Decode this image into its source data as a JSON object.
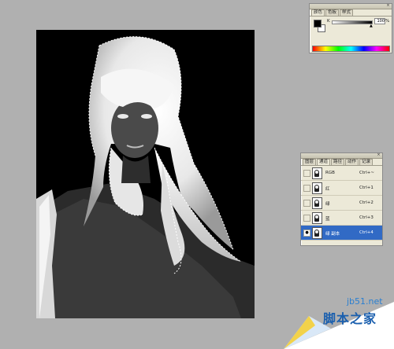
{
  "color_palette": {
    "tabs": [
      "颜色",
      "色板",
      "样式"
    ],
    "channel_label": "K",
    "value": "100",
    "unit": "%"
  },
  "channels_palette": {
    "tabs": [
      "图层",
      "通道",
      "路径",
      "动作",
      "记录"
    ],
    "rows": [
      {
        "name": "RGB",
        "shortcut": "Ctrl+~",
        "visible": false,
        "selected": false
      },
      {
        "name": "红",
        "shortcut": "Ctrl+1",
        "visible": false,
        "selected": false
      },
      {
        "name": "绿",
        "shortcut": "Ctrl+2",
        "visible": false,
        "selected": false
      },
      {
        "name": "蓝",
        "shortcut": "Ctrl+3",
        "visible": false,
        "selected": false
      },
      {
        "name": "绿 副本",
        "shortcut": "Ctrl+4",
        "visible": true,
        "selected": true
      }
    ]
  },
  "watermark": {
    "url": "jb51.net",
    "name": "脚本之家"
  },
  "colors": {
    "workspace": "#b0b0b0",
    "selection": "#316ac5",
    "palette_bg": "#ece9d8"
  }
}
